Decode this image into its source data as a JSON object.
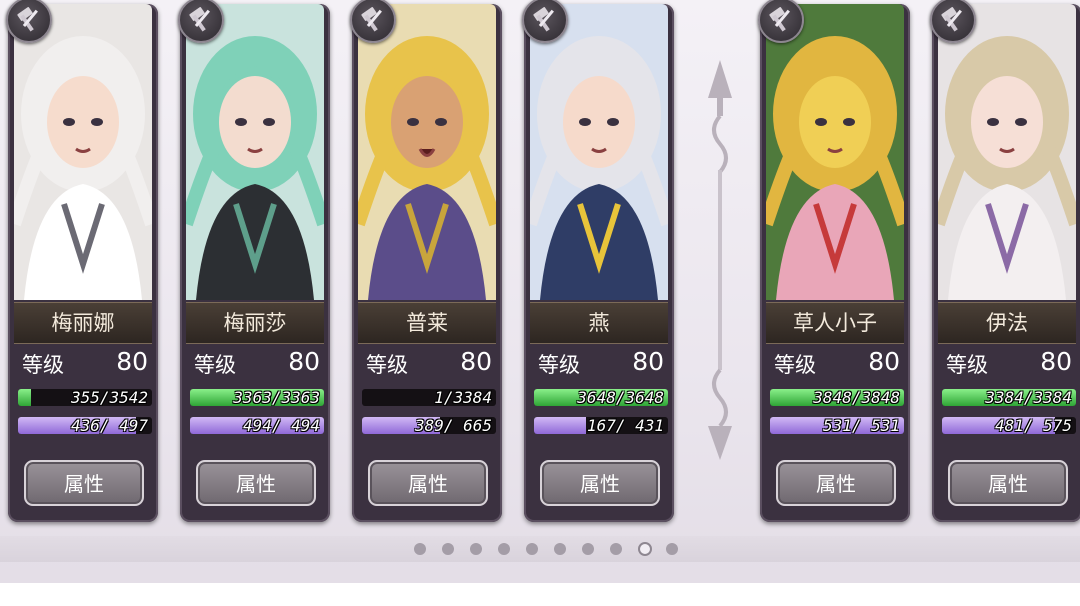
{
  "characters": [
    {
      "name": "梅丽娜",
      "level_label": "等级",
      "level": "80",
      "hp_text": "355/3542",
      "hp_fraction": 0.1,
      "mp_text": "436/ 497",
      "mp_fraction": 0.88,
      "button": "属性",
      "palette": {
        "bg": "#e9e6e4",
        "hair": "#f1efee",
        "skin": "#f6dccd",
        "cloth": "#ffffff",
        "accent": "#6b6a74"
      }
    },
    {
      "name": "梅丽莎",
      "level_label": "等级",
      "level": "80",
      "hp_text": "3363/3363",
      "hp_fraction": 1.0,
      "mp_text": "494/ 494",
      "mp_fraction": 1.0,
      "button": "属性",
      "palette": {
        "bg": "#c9e3dd",
        "hair": "#7fd1b8",
        "skin": "#f3dccf",
        "cloth": "#2c2f33",
        "accent": "#5e9f8b"
      }
    },
    {
      "name": "普莱",
      "level_label": "等级",
      "level": "80",
      "hp_text": "1/3384",
      "hp_fraction": 0.0,
      "mp_text": "389/ 665",
      "mp_fraction": 0.58,
      "button": "属性",
      "palette": {
        "bg": "#e9dcb2",
        "hair": "#e8c34b",
        "skin": "#d9a173",
        "cloth": "#5b4d8a",
        "accent": "#c8a53c"
      }
    },
    {
      "name": "燕",
      "level_label": "等级",
      "level": "80",
      "hp_text": "3648/3648",
      "hp_fraction": 1.0,
      "mp_text": "167/ 431",
      "mp_fraction": 0.39,
      "button": "属性",
      "palette": {
        "bg": "#d7e0ef",
        "hair": "#e4e4ea",
        "skin": "#f6dacb",
        "cloth": "#2f3d66",
        "accent": "#e8c43a"
      }
    },
    {
      "name": "草人小子",
      "level_label": "等级",
      "level": "80",
      "hp_text": "3848/3848",
      "hp_fraction": 1.0,
      "mp_text": "531/ 531",
      "mp_fraction": 1.0,
      "button": "属性",
      "palette": {
        "bg": "#4f7a3c",
        "hair": "#e1b640",
        "skin": "#f0cf55",
        "cloth": "#e9a6b8",
        "accent": "#c63a3a"
      }
    },
    {
      "name": "伊法",
      "level_label": "等级",
      "level": "80",
      "hp_text": "3384/3384",
      "hp_fraction": 1.0,
      "mp_text": "481/ 575",
      "mp_fraction": 0.84,
      "button": "属性",
      "palette": {
        "bg": "#e7e3e4",
        "hair": "#d8c9a8",
        "skin": "#f6dfd6",
        "cloth": "#f3eff0",
        "accent": "#8b6aa6"
      }
    }
  ],
  "colors": {
    "hp": "#3fbf47",
    "mp": "#a582e6",
    "card_frame": "#3b3140"
  },
  "badge_icon": "sword-hammer-icon",
  "pagination": {
    "count": 10,
    "active_index": 8
  }
}
